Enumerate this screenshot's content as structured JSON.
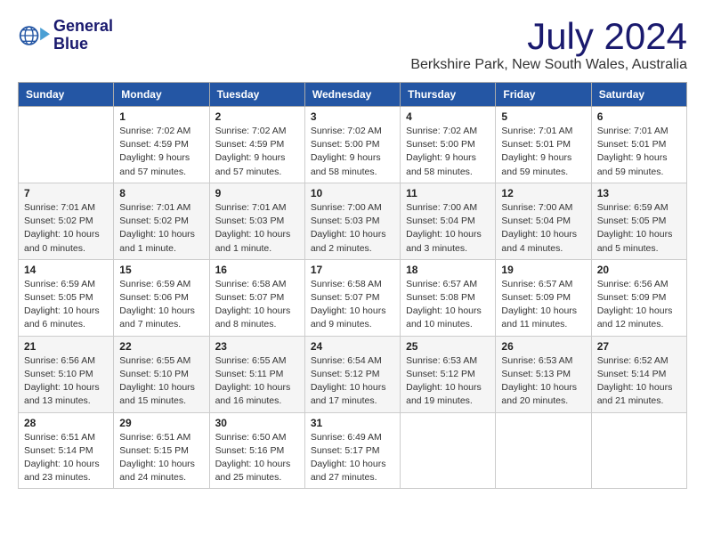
{
  "header": {
    "logo_line1": "General",
    "logo_line2": "Blue",
    "month": "July 2024",
    "location": "Berkshire Park, New South Wales, Australia"
  },
  "weekdays": [
    "Sunday",
    "Monday",
    "Tuesday",
    "Wednesday",
    "Thursday",
    "Friday",
    "Saturday"
  ],
  "weeks": [
    [
      {
        "day": "",
        "info": ""
      },
      {
        "day": "1",
        "info": "Sunrise: 7:02 AM\nSunset: 4:59 PM\nDaylight: 9 hours\nand 57 minutes."
      },
      {
        "day": "2",
        "info": "Sunrise: 7:02 AM\nSunset: 4:59 PM\nDaylight: 9 hours\nand 57 minutes."
      },
      {
        "day": "3",
        "info": "Sunrise: 7:02 AM\nSunset: 5:00 PM\nDaylight: 9 hours\nand 58 minutes."
      },
      {
        "day": "4",
        "info": "Sunrise: 7:02 AM\nSunset: 5:00 PM\nDaylight: 9 hours\nand 58 minutes."
      },
      {
        "day": "5",
        "info": "Sunrise: 7:01 AM\nSunset: 5:01 PM\nDaylight: 9 hours\nand 59 minutes."
      },
      {
        "day": "6",
        "info": "Sunrise: 7:01 AM\nSunset: 5:01 PM\nDaylight: 9 hours\nand 59 minutes."
      }
    ],
    [
      {
        "day": "7",
        "info": "Sunrise: 7:01 AM\nSunset: 5:02 PM\nDaylight: 10 hours\nand 0 minutes."
      },
      {
        "day": "8",
        "info": "Sunrise: 7:01 AM\nSunset: 5:02 PM\nDaylight: 10 hours\nand 1 minute."
      },
      {
        "day": "9",
        "info": "Sunrise: 7:01 AM\nSunset: 5:03 PM\nDaylight: 10 hours\nand 1 minute."
      },
      {
        "day": "10",
        "info": "Sunrise: 7:00 AM\nSunset: 5:03 PM\nDaylight: 10 hours\nand 2 minutes."
      },
      {
        "day": "11",
        "info": "Sunrise: 7:00 AM\nSunset: 5:04 PM\nDaylight: 10 hours\nand 3 minutes."
      },
      {
        "day": "12",
        "info": "Sunrise: 7:00 AM\nSunset: 5:04 PM\nDaylight: 10 hours\nand 4 minutes."
      },
      {
        "day": "13",
        "info": "Sunrise: 6:59 AM\nSunset: 5:05 PM\nDaylight: 10 hours\nand 5 minutes."
      }
    ],
    [
      {
        "day": "14",
        "info": "Sunrise: 6:59 AM\nSunset: 5:05 PM\nDaylight: 10 hours\nand 6 minutes."
      },
      {
        "day": "15",
        "info": "Sunrise: 6:59 AM\nSunset: 5:06 PM\nDaylight: 10 hours\nand 7 minutes."
      },
      {
        "day": "16",
        "info": "Sunrise: 6:58 AM\nSunset: 5:07 PM\nDaylight: 10 hours\nand 8 minutes."
      },
      {
        "day": "17",
        "info": "Sunrise: 6:58 AM\nSunset: 5:07 PM\nDaylight: 10 hours\nand 9 minutes."
      },
      {
        "day": "18",
        "info": "Sunrise: 6:57 AM\nSunset: 5:08 PM\nDaylight: 10 hours\nand 10 minutes."
      },
      {
        "day": "19",
        "info": "Sunrise: 6:57 AM\nSunset: 5:09 PM\nDaylight: 10 hours\nand 11 minutes."
      },
      {
        "day": "20",
        "info": "Sunrise: 6:56 AM\nSunset: 5:09 PM\nDaylight: 10 hours\nand 12 minutes."
      }
    ],
    [
      {
        "day": "21",
        "info": "Sunrise: 6:56 AM\nSunset: 5:10 PM\nDaylight: 10 hours\nand 13 minutes."
      },
      {
        "day": "22",
        "info": "Sunrise: 6:55 AM\nSunset: 5:10 PM\nDaylight: 10 hours\nand 15 minutes."
      },
      {
        "day": "23",
        "info": "Sunrise: 6:55 AM\nSunset: 5:11 PM\nDaylight: 10 hours\nand 16 minutes."
      },
      {
        "day": "24",
        "info": "Sunrise: 6:54 AM\nSunset: 5:12 PM\nDaylight: 10 hours\nand 17 minutes."
      },
      {
        "day": "25",
        "info": "Sunrise: 6:53 AM\nSunset: 5:12 PM\nDaylight: 10 hours\nand 19 minutes."
      },
      {
        "day": "26",
        "info": "Sunrise: 6:53 AM\nSunset: 5:13 PM\nDaylight: 10 hours\nand 20 minutes."
      },
      {
        "day": "27",
        "info": "Sunrise: 6:52 AM\nSunset: 5:14 PM\nDaylight: 10 hours\nand 21 minutes."
      }
    ],
    [
      {
        "day": "28",
        "info": "Sunrise: 6:51 AM\nSunset: 5:14 PM\nDaylight: 10 hours\nand 23 minutes."
      },
      {
        "day": "29",
        "info": "Sunrise: 6:51 AM\nSunset: 5:15 PM\nDaylight: 10 hours\nand 24 minutes."
      },
      {
        "day": "30",
        "info": "Sunrise: 6:50 AM\nSunset: 5:16 PM\nDaylight: 10 hours\nand 25 minutes."
      },
      {
        "day": "31",
        "info": "Sunrise: 6:49 AM\nSunset: 5:17 PM\nDaylight: 10 hours\nand 27 minutes."
      },
      {
        "day": "",
        "info": ""
      },
      {
        "day": "",
        "info": ""
      },
      {
        "day": "",
        "info": ""
      }
    ]
  ]
}
